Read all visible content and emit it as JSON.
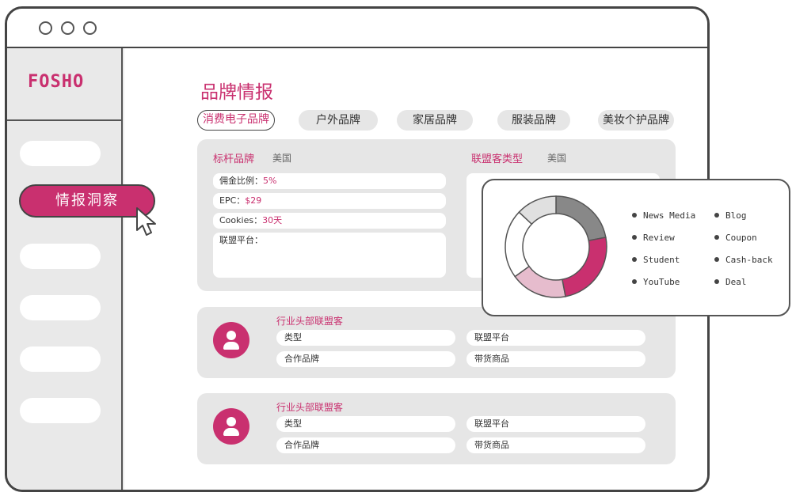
{
  "app": {
    "logo": "FOSHO"
  },
  "sidebar": {
    "active_item": "情报洞察"
  },
  "page": {
    "title": "品牌情报"
  },
  "tabs": [
    {
      "label": "消费电子品牌",
      "active": true
    },
    {
      "label": "户外品牌",
      "active": false
    },
    {
      "label": "家居品牌",
      "active": false
    },
    {
      "label": "服装品牌",
      "active": false
    },
    {
      "label": "美妆个护品牌",
      "active": false
    }
  ],
  "benchmark": {
    "label": "标杆品牌",
    "region": "美国",
    "fields": [
      {
        "key": "佣金比例：",
        "value": "5%"
      },
      {
        "key": "EPC：",
        "value": "$29"
      },
      {
        "key": "Cookies：",
        "value": "30天"
      },
      {
        "key": "联盟平台：",
        "value": ""
      }
    ]
  },
  "affiliate_types": {
    "label": "联盟客类型",
    "region": "美国"
  },
  "chart_data": {
    "type": "pie",
    "categories": [
      "News Media",
      "Blog",
      "Review",
      "Coupon",
      "Student",
      "Cash-back",
      "YouTube",
      "Deal"
    ],
    "slices": [
      {
        "value": 22,
        "color": "#888888"
      },
      {
        "value": 25,
        "color": "#c9306f"
      },
      {
        "value": 18,
        "color": "#e6bccd"
      },
      {
        "value": 22,
        "color": "#ffffff"
      },
      {
        "value": 13,
        "color": "#e0e0e0"
      }
    ],
    "legend_position": "right"
  },
  "publishers": [
    {
      "title": "行业头部联盟客",
      "type_label": "类型",
      "platform_label": "联盟平台",
      "brands_label": "合作品牌",
      "goods_label": "带货商品"
    },
    {
      "title": "行业头部联盟客",
      "type_label": "类型",
      "platform_label": "联盟平台",
      "brands_label": "合作品牌",
      "goods_label": "带货商品"
    }
  ],
  "colors": {
    "accent": "#c9306f",
    "panel": "#e6e6e6"
  }
}
